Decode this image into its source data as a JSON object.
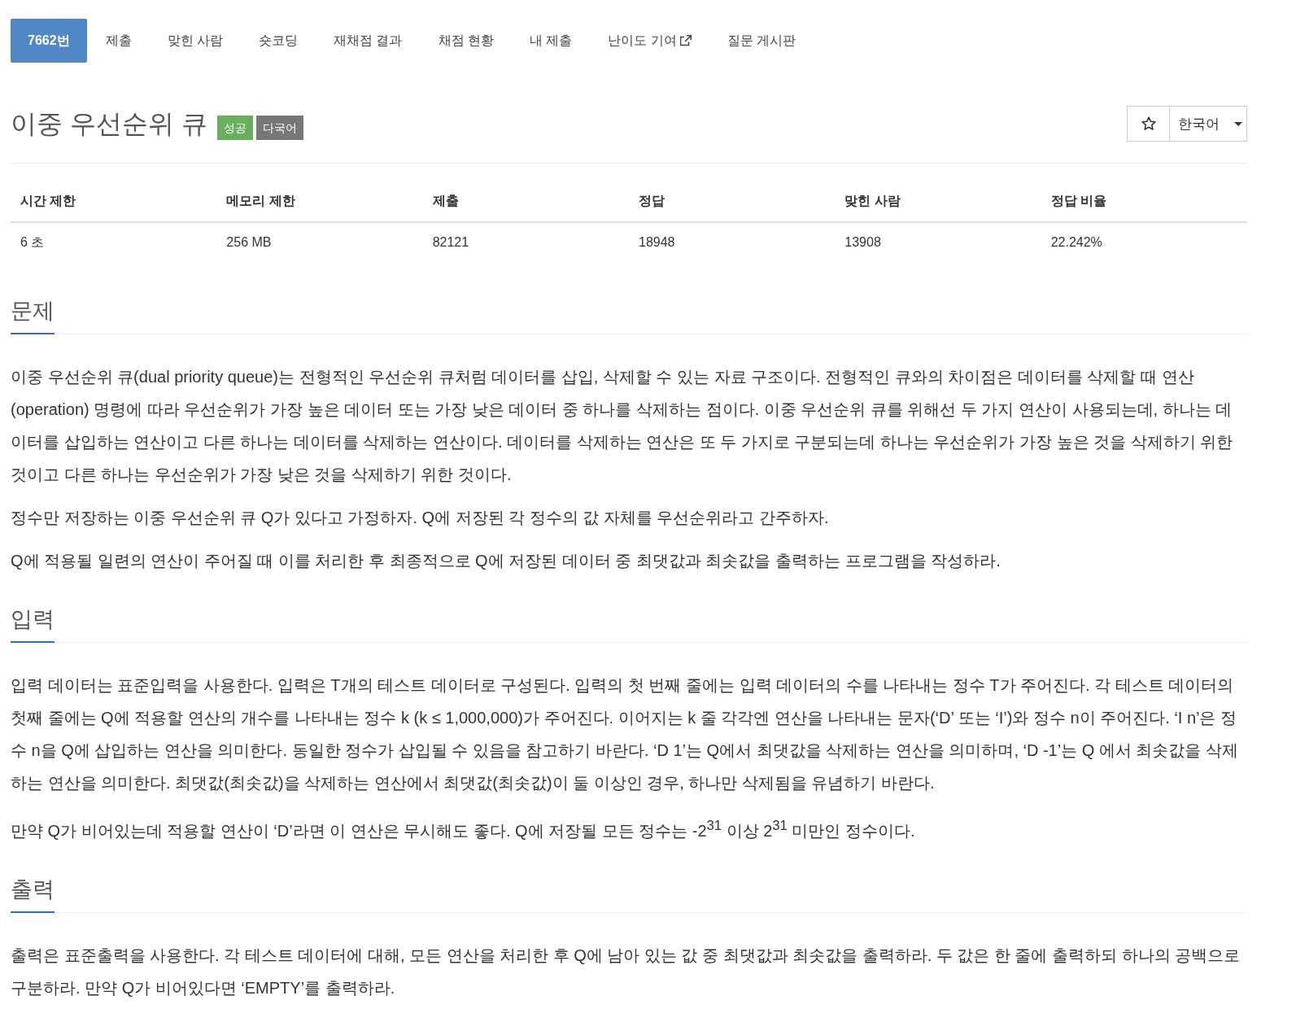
{
  "tabs": [
    {
      "label": "7662번",
      "selected": true,
      "kind": "link"
    },
    {
      "label": "제출",
      "selected": false,
      "kind": "link"
    },
    {
      "label": "맞힌 사람",
      "selected": false,
      "kind": "link"
    },
    {
      "label": "숏코딩",
      "selected": false,
      "kind": "link"
    },
    {
      "label": "재채점 결과",
      "selected": false,
      "kind": "link"
    },
    {
      "label": "채점 현황",
      "selected": false,
      "kind": "link"
    },
    {
      "label": "내 제출",
      "selected": false,
      "kind": "link"
    },
    {
      "label": "난이도 기여",
      "selected": false,
      "kind": "external"
    },
    {
      "label": "질문 게시판",
      "selected": false,
      "kind": "link"
    }
  ],
  "problem": {
    "title": "이중 우선순위 큐",
    "badges": [
      {
        "label": "성공",
        "color": "#6aaf5f"
      },
      {
        "label": "다국어",
        "color": "#777777"
      }
    ],
    "favorite": false,
    "language": "한국어"
  },
  "limits": {
    "columns": [
      "시간 제한",
      "메모리 제한",
      "제출",
      "정답",
      "맞힌 사람",
      "정답 비율"
    ],
    "rows": [
      [
        "6 초",
        "256 MB",
        "82121",
        "18948",
        "13908",
        "22.242%"
      ]
    ]
  },
  "sections": [
    {
      "heading": "문제",
      "paragraphs": [
        "이중 우선순위 큐(dual priority queue)는 전형적인 우선순위 큐처럼 데이터를 삽입, 삭제할 수 있는 자료 구조이다. 전형적인 큐와의 차이점은 데이터를 삭제할 때 연산(operation) 명령에 따라 우선순위가 가장 높은 데이터 또는 가장 낮은 데이터 중 하나를 삭제하는 점이다. 이중 우선순위 큐를 위해선 두 가지 연산이 사용되는데, 하나는 데이터를 삽입하는 연산이고 다른 하나는 데이터를 삭제하는 연산이다. 데이터를 삭제하는 연산은 또 두 가지로 구분되는데 하나는 우선순위가 가장 높은 것을 삭제하기 위한 것이고 다른 하나는 우선순위가 가장 낮은 것을 삭제하기 위한 것이다.",
        "정수만 저장하는 이중 우선순위 큐 Q가 있다고 가정하자. Q에 저장된 각 정수의 값 자체를 우선순위라고 간주하자.",
        "Q에 적용될 일련의 연산이 주어질 때 이를 처리한 후 최종적으로 Q에 저장된 데이터 중 최댓값과 최솟값을 출력하는 프로그램을 작성하라."
      ]
    },
    {
      "heading": "입력",
      "paragraphs": [
        "입력 데이터는 표준입력을 사용한다. 입력은 T개의 테스트 데이터로 구성된다. 입력의 첫 번째 줄에는 입력 데이터의 수를 나타내는 정수 T가 주어진다. 각 테스트 데이터의 첫째 줄에는 Q에 적용할 연산의 개수를 나타내는 정수 k (k ≤ 1,000,000)가 주어진다. 이어지는 k 줄 각각엔 연산을 나타내는 문자(‘D’ 또는 ‘I’)와 정수 n이 주어진다. ‘I n’은 정수 n을 Q에 삽입하는 연산을 의미한다. 동일한 정수가 삽입될 수 있음을 참고하기 바란다. ‘D 1’는 Q에서 최댓값을 삭제하는 연산을 의미하며, ‘D -1’는 Q 에서 최솟값을 삭제하는 연산을 의미한다. 최댓값(최솟값)을 삭제하는 연산에서 최댓값(최솟값)이 둘 이상인 경우, 하나만 삭제됨을 유념하기 바란다.",
        "만약 Q가 비어있는데 적용할 연산이 ‘D’라면 이 연산은 무시해도 좋다. Q에 저장될 모든 정수는 -2$^{31}$ 이상 2$^{31}$ 미만인 정수이다."
      ]
    },
    {
      "heading": "출력",
      "paragraphs": [
        "출력은 표준출력을 사용한다. 각 테스트 데이터에 대해, 모든 연산을 처리한 후 Q에 남아 있는 값 중 최댓값과 최솟값을 출력하라. 두 값은 한 줄에 출력하되 하나의 공백으로 구분하라. 만약 Q가 비어있다면 ‘EMPTY’를 출력하라."
      ]
    }
  ]
}
